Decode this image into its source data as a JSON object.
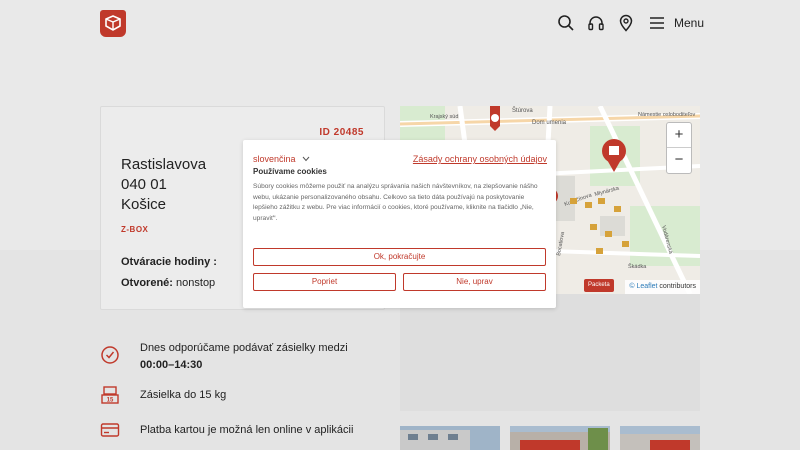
{
  "header": {
    "menu_label": "Menu",
    "icons": [
      "search-icon",
      "headphones-icon",
      "location-pin-icon",
      "hamburger-icon"
    ]
  },
  "point": {
    "id": "ID 20485",
    "street": "Rastislavova",
    "zip": "040 01",
    "city": "Košice",
    "type": "Z-BOX",
    "hours_title": "Otváracie hodiny :",
    "open_label": "Otvorené:",
    "open_value": "nonstop"
  },
  "map": {
    "zoom_in": "+",
    "zoom_out": "−",
    "brand_tag": "Packeta",
    "attribution_link": "© Leaflet",
    "attribution_rest": "contributors",
    "street_labels": [
      "Štúrova",
      "Dom umenia",
      "Krajský súd",
      "Námestie osloboditeľov",
      "Kukučínova",
      "Mlynárska",
      "Škádka",
      "Bocatiova",
      "Vodárenská"
    ],
    "accent": "#c0392b"
  },
  "info": {
    "recommend_prefix": "Dnes odporúčame podávať zásielky medzi",
    "recommend_time": "00:00–14:30",
    "weight": "Zásielka do 15 kg",
    "weight_badge": "15",
    "payment": "Platba kartou je možná len online v aplikácii"
  },
  "cookie": {
    "language": "slovenčina",
    "policy_link": "Zásady ochrany osobných údajov",
    "title": "Používame cookies",
    "body": "Súbory cookies môžeme použiť na analýzu správania našich návštevníkov, na zlepšovanie nášho webu, ukázanie personalizovaného obsahu. Celkovo sa tieto dáta používajú na poskytovanie lepšieho zážitku z webu. Pre viac informácií o cookies, ktoré používame, kliknite na tlačidlo „Nie, upraviť“.",
    "accept": "Ok, pokračujte",
    "settings": "Popriet",
    "reject": "Nie, uprav"
  }
}
